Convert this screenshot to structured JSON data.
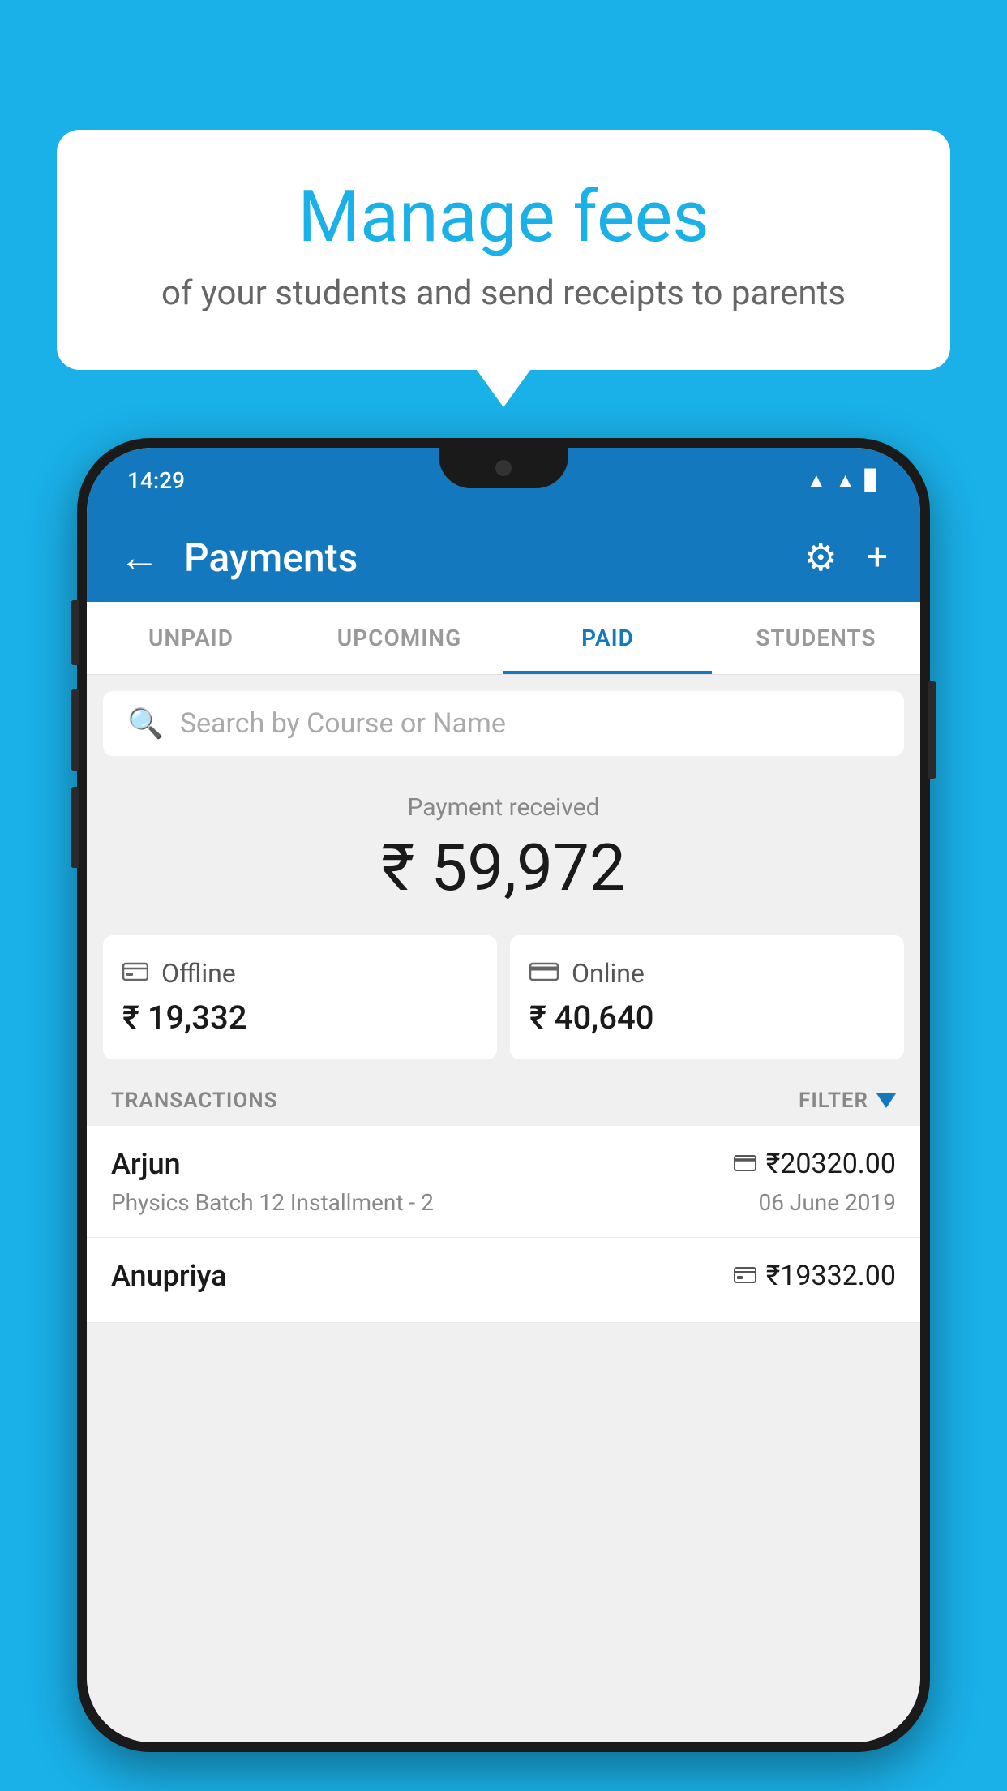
{
  "background_color": "#1ab0e8",
  "speech_bubble": {
    "title": "Manage fees",
    "subtitle": "of your students and send receipts to parents"
  },
  "phone": {
    "status_bar": {
      "time": "14:29"
    },
    "header": {
      "title": "Payments",
      "back_label": "←",
      "settings_label": "⚙",
      "add_label": "+"
    },
    "tabs": [
      {
        "label": "UNPAID",
        "active": false
      },
      {
        "label": "UPCOMING",
        "active": false
      },
      {
        "label": "PAID",
        "active": true
      },
      {
        "label": "STUDENTS",
        "active": false
      }
    ],
    "search": {
      "placeholder": "Search by Course or Name"
    },
    "payment_received": {
      "label": "Payment received",
      "amount": "₹ 59,972"
    },
    "payment_cards": [
      {
        "icon": "₹",
        "label": "Offline",
        "amount": "₹ 19,332"
      },
      {
        "icon": "💳",
        "label": "Online",
        "amount": "₹ 40,640"
      }
    ],
    "transactions_label": "TRANSACTIONS",
    "filter_label": "FILTER",
    "transactions": [
      {
        "name": "Arjun",
        "course": "Physics Batch 12 Installment - 2",
        "amount": "₹20320.00",
        "date": "06 June 2019",
        "payment_type": "online"
      },
      {
        "name": "Anupriya",
        "course": "",
        "amount": "₹19332.00",
        "date": "",
        "payment_type": "offline"
      }
    ]
  }
}
